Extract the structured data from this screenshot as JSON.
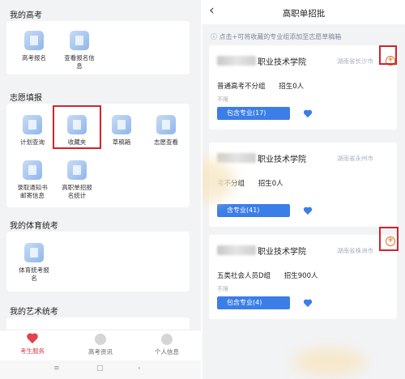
{
  "left": {
    "section_gaokao": "我的高考",
    "gaokao_apps": [
      "高考报名",
      "查看报名信息"
    ],
    "section_zhiyuan": "志愿填报",
    "zhiyuan_apps": [
      "计划查询",
      "收藏夹",
      "草稿箱",
      "志愿查看",
      "录取通知书邮寄信息",
      "高职单招报名统计"
    ],
    "section_tiyu": "我的体育统考",
    "tiyu_apps": [
      "体育统考报名"
    ],
    "section_yishu": "我的艺术统考",
    "tabs": [
      "考生服务",
      "高考资讯",
      "个人信息"
    ],
    "nav": [
      "≡",
      "□",
      "‹"
    ],
    "colors": {
      "accent": "#d8414c",
      "highlight": "#d2232a"
    }
  },
  "right": {
    "back": "‹",
    "title": "高职单招批",
    "tip": "ⓘ 点击+可将收藏的专业组添加至志愿草稿箱",
    "cards": [
      {
        "name": "职业技术学院",
        "loc": "湖南省长沙市",
        "group": "普通高考不分组",
        "enroll": "招生0人",
        "limit": "不限",
        "btn": "包含专业(17)"
      },
      {
        "name": "职业技术学院",
        "loc": "湖南省永州市",
        "group": "考不分组",
        "enroll": "招生0人",
        "limit": "",
        "btn": "含专业(41)"
      },
      {
        "name": "职业技术学院",
        "loc": "湖南省株洲市",
        "group": "五类社会人员D组",
        "enroll": "招生900人",
        "limit": "不限",
        "btn": "包含专业(4)"
      }
    ],
    "plus": "+",
    "colors": {
      "primary": "#3b7ee8",
      "plus": "#e0742a"
    }
  }
}
